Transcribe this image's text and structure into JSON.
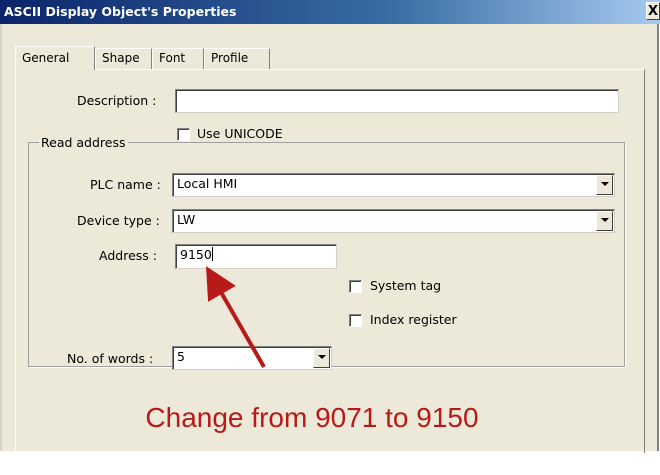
{
  "window": {
    "title": "ASCII Display Object's Properties",
    "close_label": "X"
  },
  "tabs": [
    {
      "label": "General",
      "active": true
    },
    {
      "label": "Shape",
      "active": false
    },
    {
      "label": "Font",
      "active": false
    },
    {
      "label": "Profile",
      "active": false
    }
  ],
  "description": {
    "label": "Description :",
    "value": ""
  },
  "use_unicode": {
    "label": "Use UNICODE",
    "checked": false
  },
  "read_address": {
    "group_label": "Read address",
    "plc_name": {
      "label": "PLC name :",
      "value": "Local HMI"
    },
    "device_type": {
      "label": "Device type :",
      "value": "LW"
    },
    "address": {
      "label": "Address :",
      "value": "9150"
    },
    "system_tag": {
      "label": "System tag",
      "checked": false
    },
    "index_register": {
      "label": "Index register",
      "checked": false
    }
  },
  "no_of_words": {
    "label": "No. of words :",
    "value": "5"
  },
  "annotation": {
    "text": "Change from 9071 to 9150",
    "color": "#b81919"
  }
}
